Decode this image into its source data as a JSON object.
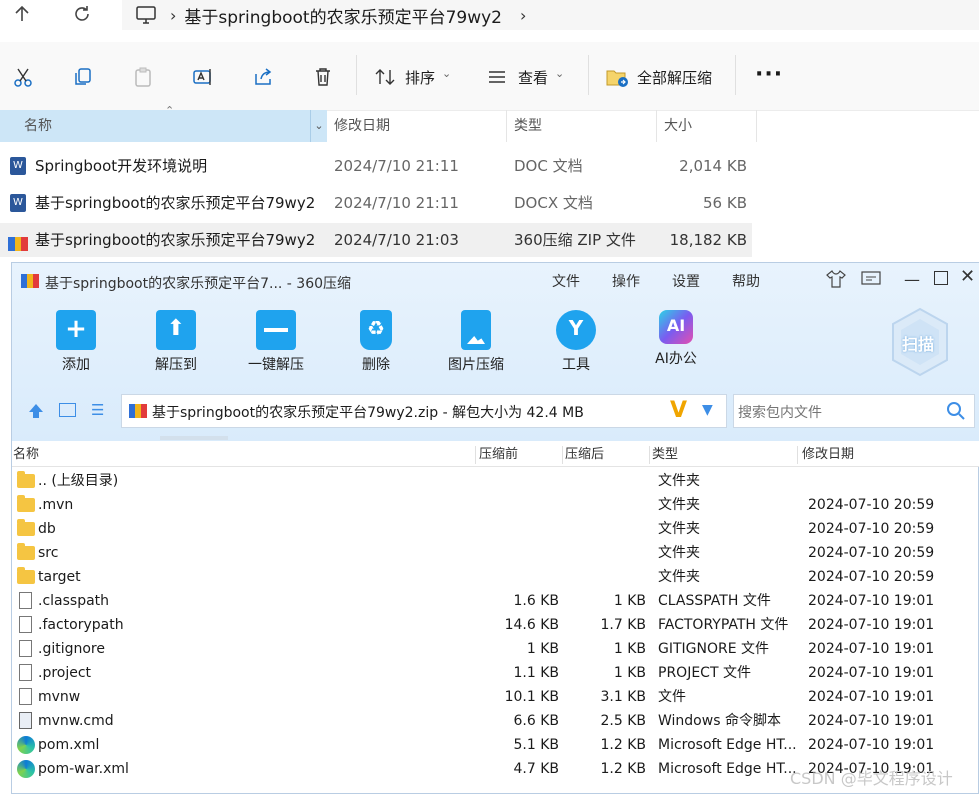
{
  "explorer": {
    "breadcrumb": "基于springboot的农家乐预定平台79wy2",
    "toolbar": {
      "sort_label": "排序",
      "view_label": "查看",
      "extract_all_label": "全部解压缩"
    },
    "columns": [
      "名称",
      "修改日期",
      "类型",
      "大小"
    ],
    "files": [
      {
        "name": "Springboot开发环境说明",
        "date": "2024/7/10 21:11",
        "type": "DOC 文档",
        "size": "2,014 KB"
      },
      {
        "name": "基于springboot的农家乐预定平台79wy2",
        "date": "2024/7/10 21:11",
        "type": "DOCX 文档",
        "size": "56 KB"
      },
      {
        "name": "基于springboot的农家乐预定平台79wy2",
        "date": "2024/7/10 21:03",
        "type": "360压缩 ZIP 文件",
        "size": "18,182 KB"
      }
    ]
  },
  "zip": {
    "title": "基于springboot的农家乐预定平台7... - 360压缩",
    "menu": [
      "文件",
      "操作",
      "设置",
      "帮助"
    ],
    "tools": [
      "添加",
      "解压到",
      "一键解压",
      "删除",
      "图片压缩",
      "工具",
      "AI办公"
    ],
    "scan_label": "扫描",
    "ai_icon_text": "AI",
    "path": "基于springboot的农家乐预定平台79wy2.zip - 解包大小为 42.4 MB",
    "search_placeholder": "搜索包内文件",
    "columns": [
      "名称",
      "压缩前",
      "压缩后",
      "类型",
      "修改日期"
    ],
    "rows": [
      {
        "name": ".. (上级目录)",
        "before": "",
        "after": "",
        "type": "文件夹",
        "date": "",
        "icon": "folder"
      },
      {
        "name": ".mvn",
        "before": "",
        "after": "",
        "type": "文件夹",
        "date": "2024-07-10 20:59",
        "icon": "folder"
      },
      {
        "name": "db",
        "before": "",
        "after": "",
        "type": "文件夹",
        "date": "2024-07-10 20:59",
        "icon": "folder"
      },
      {
        "name": "src",
        "before": "",
        "after": "",
        "type": "文件夹",
        "date": "2024-07-10 20:59",
        "icon": "folder"
      },
      {
        "name": "target",
        "before": "",
        "after": "",
        "type": "文件夹",
        "date": "2024-07-10 20:59",
        "icon": "folder"
      },
      {
        "name": ".classpath",
        "before": "1.6 KB",
        "after": "1 KB",
        "type": "CLASSPATH 文件",
        "date": "2024-07-10 19:01",
        "icon": "doc"
      },
      {
        "name": ".factorypath",
        "before": "14.6 KB",
        "after": "1.7 KB",
        "type": "FACTORYPATH 文件",
        "date": "2024-07-10 19:01",
        "icon": "doc"
      },
      {
        "name": ".gitignore",
        "before": "1 KB",
        "after": "1 KB",
        "type": "GITIGNORE 文件",
        "date": "2024-07-10 19:01",
        "icon": "doc"
      },
      {
        "name": ".project",
        "before": "1.1 KB",
        "after": "1 KB",
        "type": "PROJECT 文件",
        "date": "2024-07-10 19:01",
        "icon": "doc"
      },
      {
        "name": "mvnw",
        "before": "10.1 KB",
        "after": "3.1 KB",
        "type": "文件",
        "date": "2024-07-10 19:01",
        "icon": "doc"
      },
      {
        "name": "mvnw.cmd",
        "before": "6.6 KB",
        "after": "2.5 KB",
        "type": "Windows 命令脚本",
        "date": "2024-07-10 19:01",
        "icon": "cmd"
      },
      {
        "name": "pom.xml",
        "before": "5.1 KB",
        "after": "1.2 KB",
        "type": "Microsoft Edge HT...",
        "date": "2024-07-10 19:01",
        "icon": "edge"
      },
      {
        "name": "pom-war.xml",
        "before": "4.7 KB",
        "after": "1.2 KB",
        "type": "Microsoft Edge HT...",
        "date": "2024-07-10 19:01",
        "icon": "edge"
      }
    ]
  },
  "watermark": "CSDN @毕文程序设计"
}
